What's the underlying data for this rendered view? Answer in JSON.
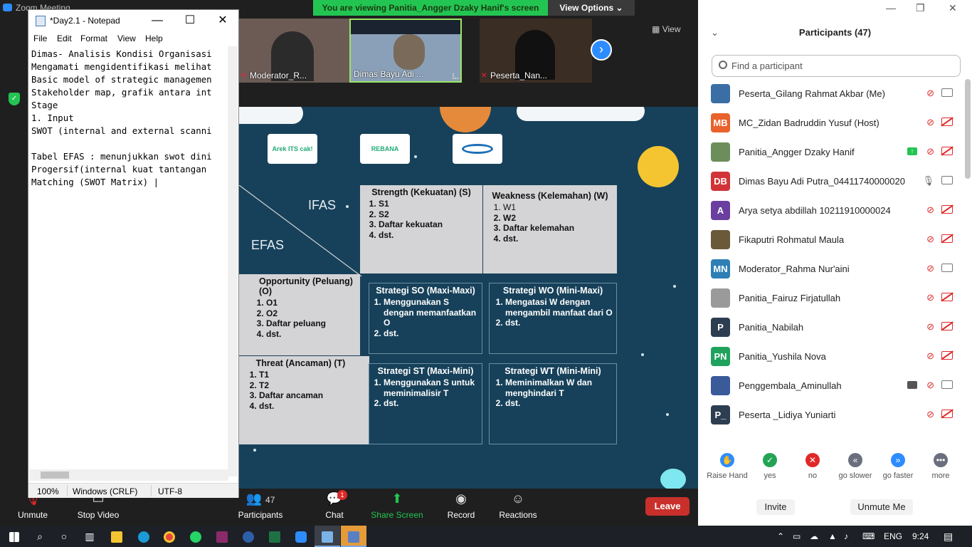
{
  "zoom": {
    "app_title": "Zoom Meeting",
    "viewing_banner": "You are viewing Panitia_Angger Dzaky Hanif's screen",
    "view_options": "View Options",
    "gallery_view_label": "View",
    "thumbnails": [
      {
        "name": "Moderator_R...",
        "muted": true
      },
      {
        "name": "Dimas Bayu Adi ...",
        "muted": false
      },
      {
        "name": "Peserta_Nan...",
        "muted": true
      }
    ],
    "controls": {
      "unmute": "Unmute",
      "stop_video": "Stop Video",
      "participants_count": "47",
      "participants": "Participants",
      "chat": "Chat",
      "chat_badge": "1",
      "share_screen": "Share Screen",
      "record": "Record",
      "reactions": "Reactions",
      "leave": "Leave"
    }
  },
  "slide": {
    "logos": [
      "Arek ITS cak!",
      "REBANA",
      ""
    ],
    "ifas_label": "IFAS",
    "efas_label": "EFAS",
    "strength": {
      "title": "Strength (Kekuatan) (S)",
      "items": [
        "S1",
        "S2",
        "Daftar kekuatan",
        "dst."
      ]
    },
    "weakness": {
      "title": "Weakness (Kelemahan) (W)",
      "items": [
        "W1",
        "W2",
        "Daftar kelemahan",
        "dst."
      ]
    },
    "opportunity": {
      "title": "Opportunity (Peluang) (O)",
      "items": [
        "O1",
        "O2",
        "Daftar peluang",
        "dst."
      ]
    },
    "threat": {
      "title": "Threat (Ancaman) (T)",
      "items": [
        "T1",
        "T2",
        "Daftar ancaman",
        "dst."
      ]
    },
    "so": {
      "title": "Strategi SO (Maxi-Maxi)",
      "items": [
        "Menggunakan S dengan memanfaatkan O",
        "dst."
      ]
    },
    "wo": {
      "title": "Strategi WO (Mini-Maxi)",
      "items": [
        "Mengatasi W dengan mengambil manfaat dari O",
        "dst."
      ]
    },
    "st": {
      "title": "Strategi  ST (Maxi-Mini)",
      "items": [
        "Menggunakan S untuk meminimalisir T",
        "dst."
      ]
    },
    "wt": {
      "title": "Strategi WT (Mini-Mini)",
      "items": [
        "Meminimalkan W dan menghindari T",
        "dst."
      ]
    }
  },
  "notepad": {
    "title": "*Day2.1 - Notepad",
    "menu": [
      "File",
      "Edit",
      "Format",
      "View",
      "Help"
    ],
    "text": "Dimas- Analisis Kondisi Organisasi\nMengamati mengidentifikasi melihat\nBasic model of strategic managemen\nStakeholder map, grafik antara int\nStage\n1. Input\nSWOT (internal and external scanni\n\nTabel EFAS : menunjukkan swot dini\nProgersif(internal kuat tantangan\nMatching (SWOT Matrix) |",
    "status": {
      "zoom": "100%",
      "line_endings": "Windows (CRLF)",
      "encoding": "UTF-8"
    }
  },
  "participants": {
    "title": "Participants (47)",
    "search_placeholder": "Find a participant",
    "list": [
      {
        "name": "Peserta_Gilang Rahmat Akbar (Me)",
        "initials": "",
        "avatar_color": "#3a6ea5",
        "mic": "off",
        "cam": "on"
      },
      {
        "name": "MC_Zidan Badruddin Yusuf (Host)",
        "initials": "MB",
        "avatar_color": "#e8622b",
        "mic": "off",
        "cam": "off"
      },
      {
        "name": "Panitia_Angger Dzaky Hanif",
        "initials": "",
        "avatar_color": "#6b8e5a",
        "mic": "off",
        "cam": "off",
        "sharing": true
      },
      {
        "name": "Dimas Bayu Adi Putra_04411740000020",
        "initials": "DB",
        "avatar_color": "#d13438",
        "mic": "on",
        "cam": "on"
      },
      {
        "name": "Arya setya abdillah 10211910000024",
        "initials": "A",
        "avatar_color": "#6b3fa0",
        "mic": "off",
        "cam": "off"
      },
      {
        "name": "Fikaputri Rohmatul Maula",
        "initials": "",
        "avatar_color": "#6a5a3a",
        "mic": "off",
        "cam": "off"
      },
      {
        "name": "Moderator_Rahma Nur'aini",
        "initials": "MN",
        "avatar_color": "#2d7fb5",
        "mic": "off",
        "cam": "on"
      },
      {
        "name": "Panitia_Fairuz Firjatullah",
        "initials": "",
        "avatar_color": "#9a9a9a",
        "mic": "off",
        "cam": "off"
      },
      {
        "name": "Panitia_Nabilah",
        "initials": "P",
        "avatar_color": "#2c3e50",
        "mic": "off",
        "cam": "off"
      },
      {
        "name": "Panitia_Yushila Nova",
        "initials": "PN",
        "avatar_color": "#1fa35c",
        "mic": "off",
        "cam": "off"
      },
      {
        "name": "Penggembala_Aminullah",
        "initials": "",
        "avatar_color": "#3a5a9a",
        "mic": "off",
        "cam": "on",
        "speaker": true
      },
      {
        "name": "Peserta _Lidiya Yuniarti",
        "initials": "P_",
        "avatar_color": "#2c3e50",
        "mic": "off",
        "cam": "off"
      }
    ],
    "reactions": [
      {
        "label": "Raise Hand",
        "color": "#2d8cff",
        "glyph": "✋"
      },
      {
        "label": "yes",
        "color": "#23a455",
        "glyph": "✓"
      },
      {
        "label": "no",
        "color": "#e02828",
        "glyph": "✕"
      },
      {
        "label": "go slower",
        "color": "#6b6f7d",
        "glyph": "«"
      },
      {
        "label": "go faster",
        "color": "#2d8cff",
        "glyph": "»"
      },
      {
        "label": "more",
        "color": "#6b6f7d",
        "glyph": "•••"
      }
    ],
    "invite": "Invite",
    "unmute_me": "Unmute Me"
  },
  "taskbar": {
    "language": "ENG",
    "time": "9:24"
  }
}
